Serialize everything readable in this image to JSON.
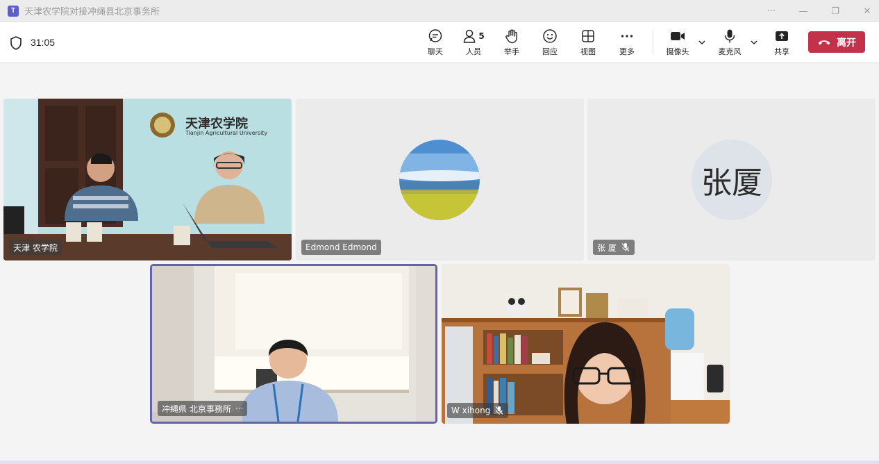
{
  "window": {
    "title": "天津农学院对接冲绳县北京事务所",
    "app_icon": "teams-icon",
    "controls": [
      "···",
      "—",
      "❐",
      "✕"
    ]
  },
  "toolbar": {
    "shield_icon": "shield-icon",
    "timer": "31:05",
    "buttons": [
      {
        "label": "聊天",
        "icon": "chat-icon"
      },
      {
        "label": "人员",
        "icon": "people-icon",
        "count": "5"
      },
      {
        "label": "举手",
        "icon": "raise-hand-icon"
      },
      {
        "label": "回应",
        "icon": "emoji-icon"
      },
      {
        "label": "视图",
        "icon": "grid-view-icon"
      },
      {
        "label": "更多",
        "icon": "more-icon"
      }
    ],
    "camera": {
      "label": "摄像头",
      "icon": "camera-icon"
    },
    "mic": {
      "label": "麦克风",
      "icon": "microphone-icon"
    },
    "share": {
      "label": "共享",
      "icon": "share-icon"
    },
    "leave": {
      "label": "离开",
      "icon": "hangup-icon",
      "color": "#c4314b"
    }
  },
  "participants": [
    {
      "name": "天津 农学院",
      "type": "video",
      "muted": false
    },
    {
      "name": "Edmond Edmond",
      "type": "avatar-photo",
      "muted": false
    },
    {
      "name": "张 厦",
      "type": "initials",
      "initials": "张厦",
      "muted": true
    },
    {
      "name": "冲縄県 北京事務所",
      "type": "video",
      "muted": false,
      "active_speaker": true,
      "more": "···"
    },
    {
      "name": "W xihong",
      "type": "video",
      "muted": true
    }
  ],
  "room_sign": {
    "cn": "天津农学院",
    "en": "Tianjin Agricultural University"
  },
  "colors": {
    "accent": "#6264a7",
    "leave": "#c4314b"
  }
}
